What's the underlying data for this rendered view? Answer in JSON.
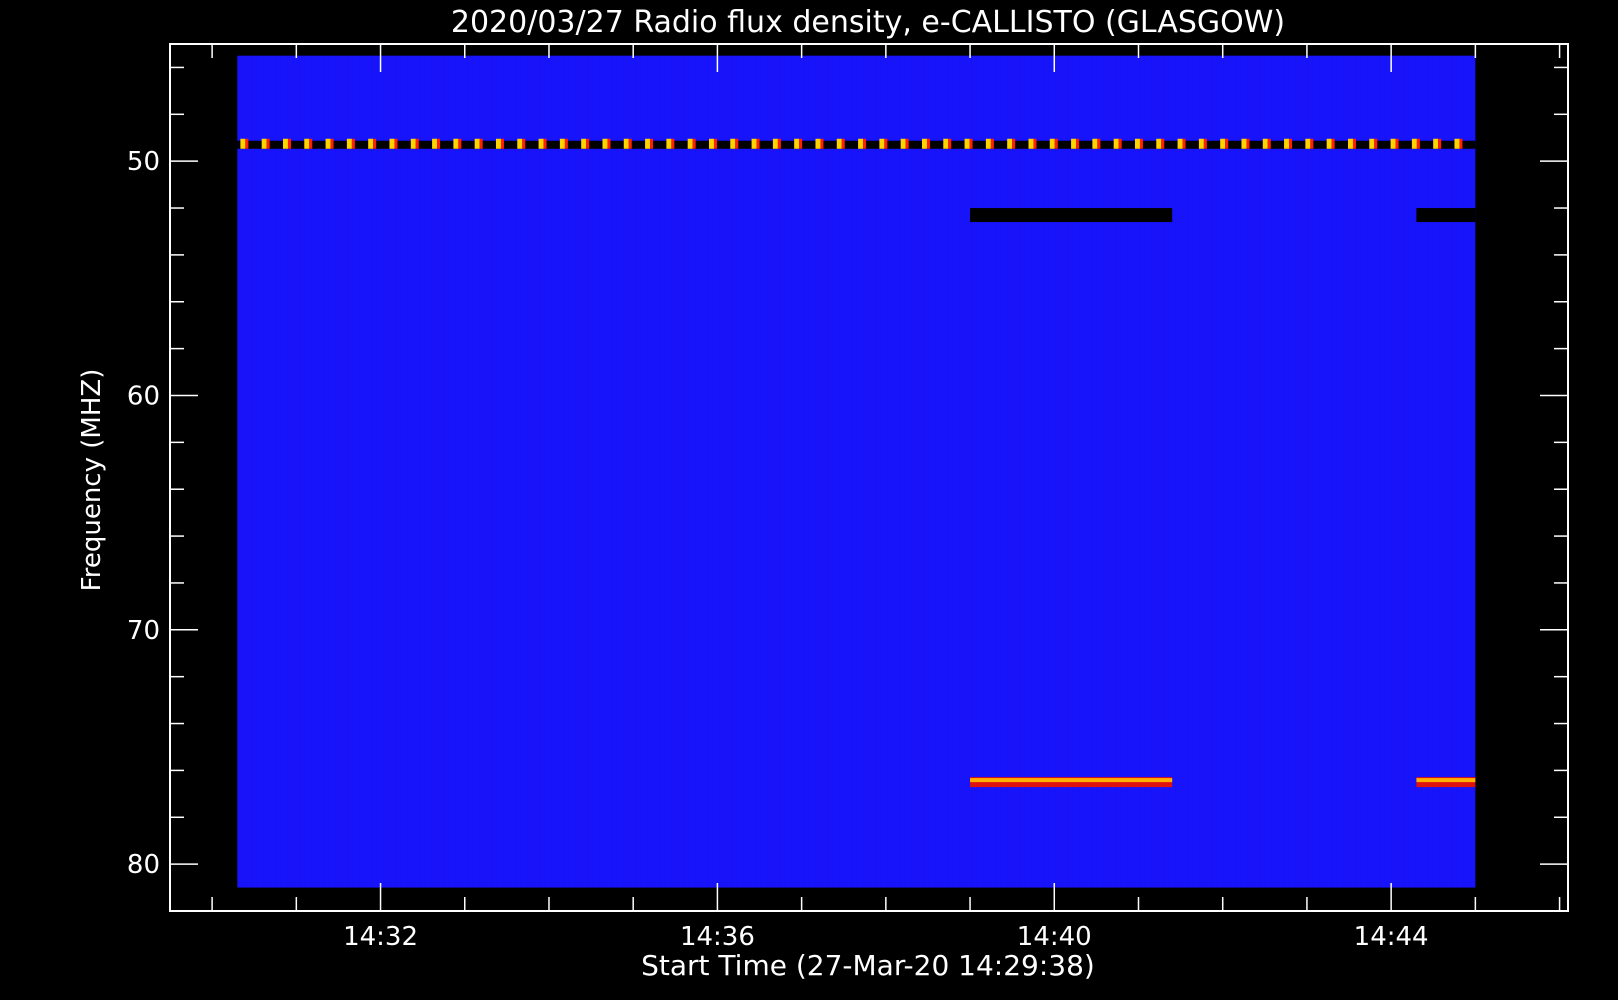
{
  "chart_data": {
    "type": "heatmap",
    "title": "2020/03/27  Radio flux density, e-CALLISTO (GLASGOW)",
    "xlabel": "Start Time (27-Mar-20 14:29:38)",
    "ylabel": "Frequency (MHZ)",
    "x_ticks": [
      "14:32",
      "14:36",
      "14:40",
      "14:44"
    ],
    "y_ticks": [
      "50",
      "60",
      "70",
      "80"
    ],
    "y_tick_values": [
      50,
      60,
      70,
      80
    ],
    "x_tick_minutes": [
      32,
      36,
      40,
      44
    ],
    "xlim_minutes": [
      29.5,
      46.1
    ],
    "data_x_range_minutes": [
      30.3,
      45.0
    ],
    "ylim": [
      45,
      82
    ],
    "data_y_range": [
      45.5,
      81.0
    ],
    "y_reversed": true,
    "background_color": "#1414ff",
    "features": [
      {
        "kind": "interference-band",
        "freq": 49.3,
        "t_start": 30.3,
        "t_end": 45.0,
        "colors": [
          "#ffd400",
          "#ff2000",
          "#000000"
        ]
      },
      {
        "kind": "gap",
        "freq": 52.3,
        "t_start": 39.0,
        "t_end": 41.4
      },
      {
        "kind": "gap",
        "freq": 52.3,
        "t_start": 44.3,
        "t_end": 45.0
      },
      {
        "kind": "emission-line",
        "freq": 76.5,
        "t_start": 39.0,
        "t_end": 41.4
      },
      {
        "kind": "emission-line",
        "freq": 76.5,
        "t_start": 44.3,
        "t_end": 45.0
      }
    ]
  }
}
